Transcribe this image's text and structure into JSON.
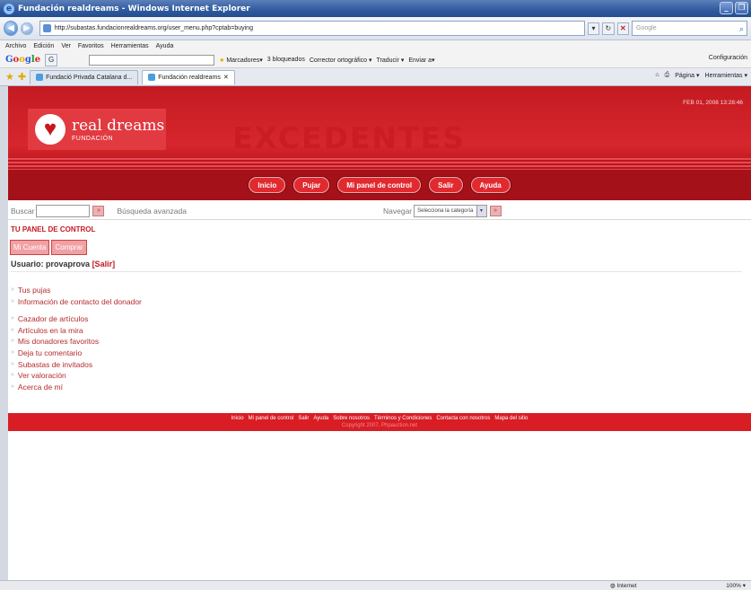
{
  "window": {
    "title": "Fundación realdreams - Windows Internet Explorer"
  },
  "browser": {
    "url": "http://subastas.fundacionrealdreams.org/user_menu.php?cptab=buying",
    "search_placeholder": "Google",
    "menu": [
      "Archivo",
      "Edición",
      "Ver",
      "Favoritos",
      "Herramientas",
      "Ayuda"
    ],
    "google_toolbar": {
      "logo": "Google",
      "items": [
        "Marcadores▾",
        "3 bloqueados",
        "Corrector ortográfico ▾",
        "Traducir ▾",
        "Enviar a▾"
      ],
      "config": "Configuración"
    },
    "tabs": [
      "Fundació Privada Catalana d...",
      "Fundación realdreams"
    ],
    "tab_tools": [
      "Página ▾",
      "Herramientas ▾"
    ],
    "status": {
      "zone": "Internet",
      "zoom": "100% ▾"
    }
  },
  "header": {
    "logo_brand": "real dreams",
    "logo_sub": "FUNDACIÓN",
    "watermark": "EXCEDENTES",
    "datetime": "FEB 01, 2008 13:28:46"
  },
  "nav": [
    "Inicio",
    "Pujar",
    "Mi panel de control",
    "Salir",
    "Ayuda"
  ],
  "search": {
    "label": "Buscar",
    "go": "»",
    "advanced": "Búsqueda avanzada",
    "navigate_label": "Navegar",
    "category": "Selecciona la categoría"
  },
  "panel": {
    "title": "TU PANEL DE CONTROL",
    "tabs": [
      "Mi Cuenta",
      "Comprar"
    ],
    "user_prefix": "Usuario: ",
    "username": "provaprova",
    "logout": "[Salir]"
  },
  "links_group1": [
    "Tus pujas",
    "Información de contacto del donador"
  ],
  "links_group2": [
    "Cazador de artículos",
    "Artículos en la mira",
    "Mis donadores favoritos",
    "Deja tu comentario",
    "Subastas de invitados",
    "Ver valoración",
    "Acerca de mí"
  ],
  "footer": {
    "links": [
      "Inicio",
      "Mi panel de control",
      "Salir",
      "Ayuda",
      "Sobre nosotros",
      "Términos y Condiciones",
      "Contacta con nosotros",
      "Mapa del sitio"
    ],
    "copyright": "Copyright 2007, Phpauction.net"
  }
}
